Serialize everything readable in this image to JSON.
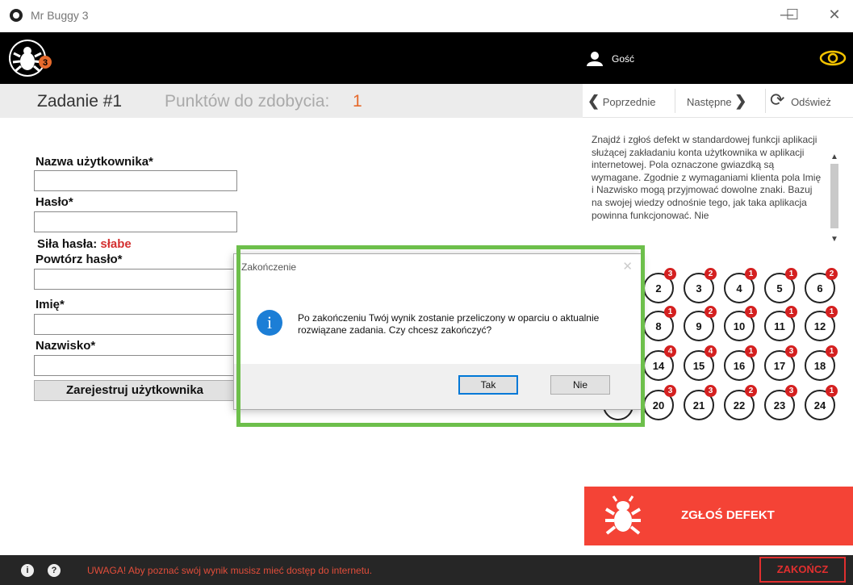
{
  "window": {
    "title": "Mr Buggy 3",
    "controls": {
      "minimize": "—",
      "maximize": "☐",
      "close": "✕"
    }
  },
  "header": {
    "logo_badge": "3",
    "user_name": "Gość"
  },
  "task": {
    "title": "Zadanie #1",
    "points_label": "Punktów do zdobycia:",
    "points_value": "1"
  },
  "nav": {
    "prev": "Poprzednie",
    "next": "Następne",
    "refresh": "Odśwież"
  },
  "form": {
    "username_label": "Nazwa użytkownika*",
    "password_label": "Hasło*",
    "strength_label": "Siła hasła:",
    "strength_value": "słabe",
    "repeat_label": "Powtórz hasło*",
    "firstname_label": "Imię*",
    "lastname_label": "Nazwisko*",
    "register_button": "Zarejestruj użytkownika"
  },
  "description": "Znajdź i zgłoś defekt w standardowej funkcji aplikacji służącej zakładaniu konta użytkownika w aplikacji internetowej. Pola oznaczone gwiazdką są wymagane. Zgodnie z wymaganiami klienta pola Imię i Nazwisko mogą przyjmować dowolne znaki. Bazuj na swojej wiedzy odnośnie tego, jak taka aplikacja powinna funkcjonować. Nie",
  "tasks": [
    {
      "num": "2",
      "badge": "3"
    },
    {
      "num": "3",
      "badge": "2"
    },
    {
      "num": "4",
      "badge": "1"
    },
    {
      "num": "5",
      "badge": "1"
    },
    {
      "num": "6",
      "badge": "2"
    },
    {
      "num": "8",
      "badge": "1"
    },
    {
      "num": "9",
      "badge": "2"
    },
    {
      "num": "10",
      "badge": "1"
    },
    {
      "num": "11",
      "badge": "1"
    },
    {
      "num": "12",
      "badge": "1"
    },
    {
      "num": "14",
      "badge": "4"
    },
    {
      "num": "15",
      "badge": "4"
    },
    {
      "num": "16",
      "badge": "1"
    },
    {
      "num": "17",
      "badge": "3"
    },
    {
      "num": "18",
      "badge": "1"
    },
    {
      "num": "19",
      "badge": ""
    },
    {
      "num": "20",
      "badge": "3"
    },
    {
      "num": "21",
      "badge": "3"
    },
    {
      "num": "22",
      "badge": "2"
    },
    {
      "num": "23",
      "badge": "3"
    },
    {
      "num": "24",
      "badge": "1"
    }
  ],
  "report_button": "ZGŁOŚ DEFEKT",
  "footer": {
    "warning": "UWAGA! Aby poznać swój wynik musisz mieć dostęp do internetu.",
    "finish_button": "ZAKOŃCZ"
  },
  "dialog": {
    "title": "Zakończenie",
    "message": "Po zakończeniu Twój wynik zostanie przeliczony w oparciu o aktualnie rozwiązane zadania. Czy chcesz zakończyć?",
    "yes": "Tak",
    "no": "Nie"
  },
  "colors": {
    "accent_orange": "#e66a2c",
    "report_red": "#f44336",
    "highlight_green": "#6dbf4b",
    "info_blue": "#1c7ed6"
  }
}
